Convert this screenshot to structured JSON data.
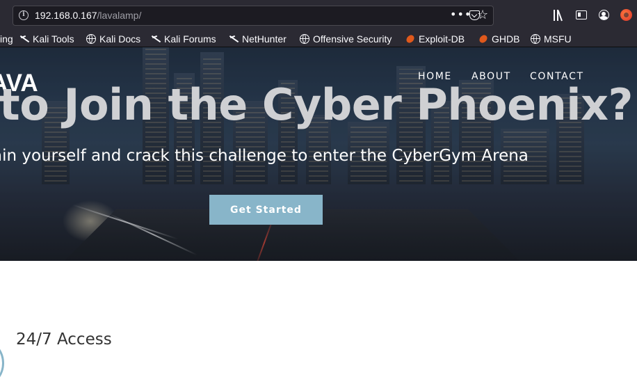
{
  "browser": {
    "url_host": "192.168.0.167",
    "url_path": "/lavalamp/",
    "more_label": "•••",
    "star_label": "☆"
  },
  "bookmarks": [
    {
      "label": "ing",
      "icon": "none"
    },
    {
      "label": "Kali Tools",
      "icon": "kali-dragon-icon"
    },
    {
      "label": "Kali Docs",
      "icon": "globe-icon"
    },
    {
      "label": "Kali Forums",
      "icon": "kali-dragon-icon"
    },
    {
      "label": "NetHunter",
      "icon": "kali-dragon-icon"
    },
    {
      "label": "Offensive Security",
      "icon": "globe-icon"
    },
    {
      "label": "Exploit-DB",
      "icon": "exploit-db-icon"
    },
    {
      "label": "GHDB",
      "icon": "exploit-db-icon"
    },
    {
      "label": "MSFU",
      "icon": "globe-icon"
    }
  ],
  "site": {
    "logo": "AVA",
    "nav": [
      "HOME",
      "ABOUT",
      "CONTACT"
    ],
    "headline": "dy to Join the Cyber Phoenix?",
    "subline": "ain yourself and crack this challenge to enter the CyberGym Arena",
    "cta_label": "Get Started",
    "feature_title": "24/7 Access"
  },
  "colors": {
    "chrome": "#2b2a33",
    "accent": "#88b5c9",
    "text_dark": "#333333"
  }
}
